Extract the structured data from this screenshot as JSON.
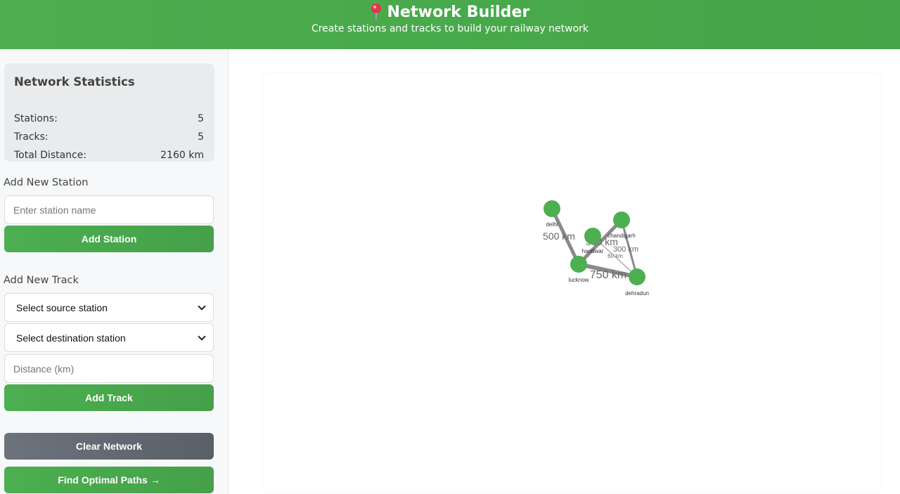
{
  "header": {
    "title": "Network Builder",
    "subtitle": "Create stations and tracks to build your railway network",
    "icon": "map-pin-icon"
  },
  "stats": {
    "heading": "Network Statistics",
    "rows": [
      {
        "label": "Stations:",
        "value": "5"
      },
      {
        "label": "Tracks:",
        "value": "5"
      },
      {
        "label": "Total Distance:",
        "value": "2160 km"
      }
    ]
  },
  "add_station": {
    "label": "Add New Station",
    "placeholder": "Enter station name",
    "button": "Add Station"
  },
  "add_track": {
    "label": "Add New Track",
    "source_select": "Select source station",
    "destination_select": "Select destination station",
    "distance_placeholder": "Distance (km)",
    "button": "Add Track"
  },
  "actions": {
    "clear": "Clear Network",
    "find_paths": "Find Optimal Paths →"
  },
  "graph": {
    "stations": [
      "delhi",
      "haridwar",
      "chandigarh",
      "lucknow",
      "dehradun"
    ],
    "tracks": [
      {
        "from": "delhi",
        "to": "lucknow",
        "label": "500 km"
      },
      {
        "from": "lucknow",
        "to": "chandigarh",
        "label": "550 km"
      },
      {
        "from": "chandigarh",
        "to": "dehradun",
        "label": "300 km"
      },
      {
        "from": "haridwar",
        "to": "dehradun",
        "label": "60 km"
      },
      {
        "from": "lucknow",
        "to": "dehradun",
        "label": "750 km"
      }
    ]
  },
  "colors": {
    "primary": "#4caf50",
    "secondary": "#6c737c",
    "edge": "#8a8a8a"
  }
}
